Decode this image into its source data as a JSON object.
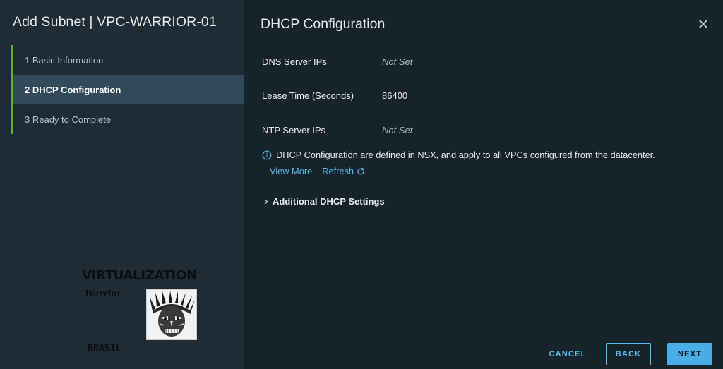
{
  "sidebar": {
    "title": "Add Subnet | VPC-WARRIOR-01",
    "steps": [
      {
        "label": "1  Basic Information"
      },
      {
        "label": "2  DHCP Configuration"
      },
      {
        "label": "3  Ready to Complete"
      }
    ],
    "active_step": 2,
    "step_accent": "#5fb030"
  },
  "logo": {
    "title": "VIRTUALIZATION",
    "script": "Warrior",
    "country": "BRASIL"
  },
  "main": {
    "title": "DHCP Configuration",
    "fields": [
      {
        "label": "DNS Server IPs",
        "value": "Not Set"
      },
      {
        "label": "Lease Time (Seconds)",
        "value": "86400"
      },
      {
        "label": "NTP Server IPs",
        "value": "Not Set"
      }
    ],
    "info_text": "DHCP Configuration are defined in NSX, and apply to all VPCs configured from the datacenter.",
    "view_more_label": "View More",
    "refresh_label": "Refresh",
    "expander_label": "Additional DHCP Settings"
  },
  "footer": {
    "cancel_label": "CANCEL",
    "back_label": "BACK",
    "next_label": "NEXT"
  },
  "colors": {
    "link": "#5ab8ea",
    "primary_button": "#49aee6",
    "sidebar_bg": "#1f2c36",
    "content_bg": "#17232b"
  }
}
